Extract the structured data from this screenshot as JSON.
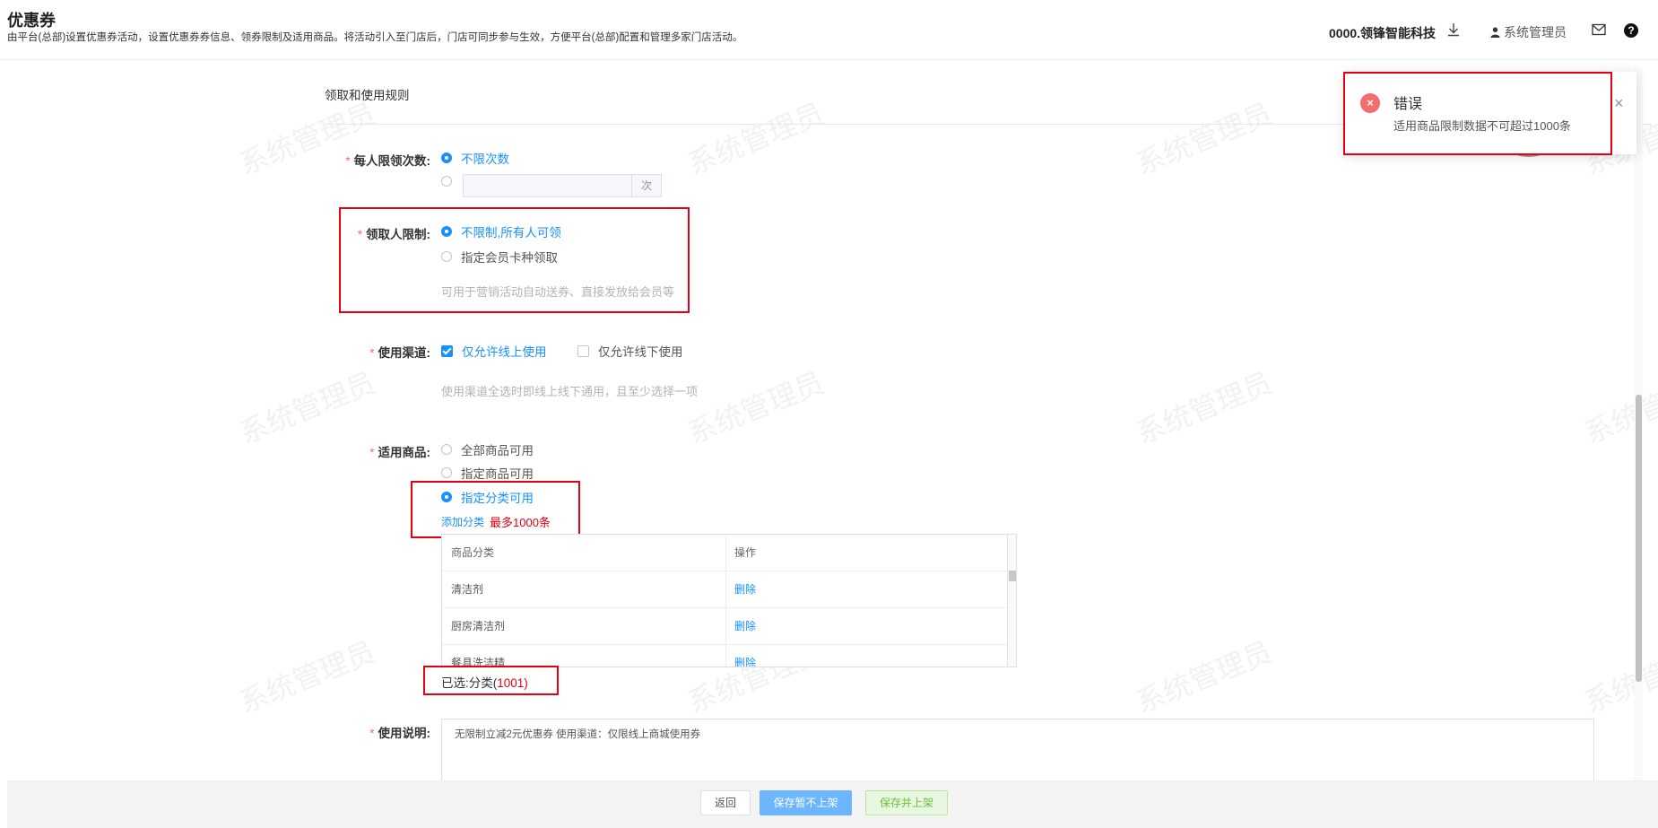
{
  "header": {
    "title": "优惠券",
    "description": "由平台(总部)设置优惠券活动，设置优惠券券信息、领券限制及适用商品。将活动引入至门店后，门店可同步参与生效，方便平台(总部)配置和管理多家门店活动。",
    "org_name": "0000.领锋智能科技",
    "user_name": "系统管理员",
    "help_glyph": "?"
  },
  "watermark": "系统管理员",
  "section": {
    "title": "领取和使用规则"
  },
  "per_person_limit": {
    "label": "每人限领次数:",
    "option_unlimited": "不限次数",
    "times_suffix": "次"
  },
  "receiver_limit": {
    "label": "领取人限制:",
    "option_all": "不限制,所有人可领",
    "option_member": "指定会员卡种领取",
    "hint": "可用于营销活动自动送券、直接发放给会员等"
  },
  "channel": {
    "label": "使用渠道:",
    "option_online": "仅允许线上使用",
    "option_offline": "仅允许线下使用",
    "hint": "使用渠道全选时即线上线下通用，且至少选择一项"
  },
  "goods": {
    "label": "适用商品:",
    "option_all": "全部商品可用",
    "option_specific": "指定商品可用",
    "option_category": "指定分类可用",
    "add_category": "添加分类",
    "max_note": "最多1000条",
    "table": {
      "headers": [
        "商品分类",
        "操作"
      ],
      "rows": [
        {
          "category": "清洁剂",
          "action": "删除"
        },
        {
          "category": "厨房清洁剂",
          "action": "删除"
        },
        {
          "category": "餐具洗洁精",
          "action": "删除"
        }
      ]
    },
    "selected_prefix": "已选:分类(",
    "selected_count": "1001",
    "selected_suffix": ")"
  },
  "usage_note": {
    "label": "使用说明:",
    "value": "无限制立减2元优惠券 使用渠道：仅限线上商城使用券"
  },
  "footer": {
    "back_label": "返回",
    "save_label": "保存暂不上架",
    "publish_label": "保存并上架"
  },
  "toast": {
    "title": "错误",
    "message": "适用商品限制数据不可超过1000条",
    "close_glyph": "×",
    "icon_glyph": "×"
  },
  "colors": {
    "primary": "#1890ff",
    "error": "#f56c6c",
    "annotation_red": "#e60012",
    "success": "#67c23a"
  }
}
